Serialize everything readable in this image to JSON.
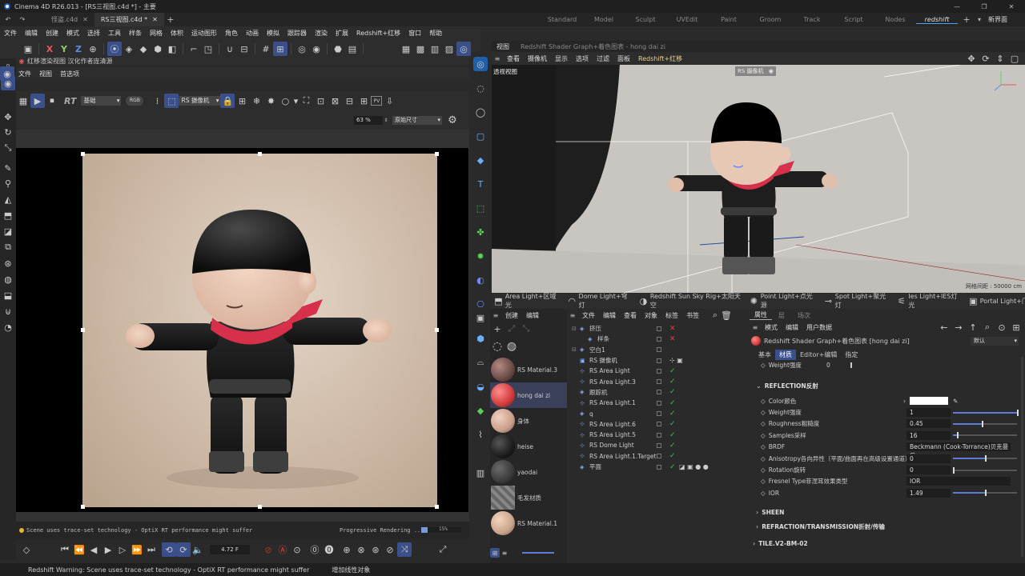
{
  "app": {
    "title": "Cinema 4D R26.013 - [RS三视图.c4d *] - 主要"
  },
  "doc_tabs": [
    {
      "label": "怪盗.c4d",
      "active": false
    },
    {
      "label": "RS三视图.c4d *",
      "active": true
    }
  ],
  "layout_tabs": [
    "Standard",
    "Model",
    "Sculpt",
    "UVEdit",
    "Paint",
    "Groom",
    "Track",
    "Script",
    "Nodes",
    "redshift"
  ],
  "layout_active": "redshift",
  "layout_new": "新界面",
  "menu": [
    "文件",
    "编辑",
    "创建",
    "模式",
    "选择",
    "工具",
    "样条",
    "网格",
    "体积",
    "运动图形",
    "角色",
    "动画",
    "模拟",
    "跟踪器",
    "渲染",
    "扩展",
    "Redshift+红移",
    "窗口",
    "帮助"
  ],
  "axis_labels": [
    "X",
    "Y",
    "Z"
  ],
  "render_view": {
    "title": "红移渲染视图 汉化作者庞清源",
    "menu": [
      "文件",
      "视图",
      "首选项"
    ],
    "rt_label": "RT",
    "mode_select": "基础",
    "color_select": "RGB",
    "camera_select": "RS 摄像机",
    "zoom": "63 %",
    "size_select": "原始尺寸",
    "status_msg": "Scene uses trace-set technology - OptiX RT performance might suffer",
    "progress_label": "Progressive Rendering ..",
    "progress_pct": "15%",
    "frame": "4.72 F"
  },
  "status_bar": {
    "warning": "Redshift Warning: Scene uses trace-set technology - OptiX RT performance might suffer",
    "hint": "增加线性对象"
  },
  "viewport": {
    "tabs": [
      "视图",
      "Redshift Shader Graph+着色图表 - hong dai zi"
    ],
    "menu": [
      "查看",
      "摄像机",
      "显示",
      "选项",
      "过滤",
      "面板",
      "Redshift+红移"
    ],
    "label": "透视视图",
    "camera_label": "RS 摄像机",
    "grid_info": "网格间距 : 50000 cm"
  },
  "light_bar": [
    "Area Light+区域光",
    "Dome Light+穹灯",
    "Redshift Sun Sky Rig+太阳天空",
    "Point Light+点光源",
    "Spot Light+聚光灯",
    "Ies Light+IES灯光",
    "Portal Light+门"
  ],
  "materials": {
    "menu": [
      "创建",
      "编辑"
    ],
    "items": [
      {
        "name": "RS Material.3",
        "color": "#6b4a46"
      },
      {
        "name": "hong dai zi",
        "color": "#d23b3b",
        "selected": true
      },
      {
        "name": "身体",
        "color": "#c9a08c"
      },
      {
        "name": "heise",
        "color": "#1e1e1e"
      },
      {
        "name": "yaodai",
        "color": "#3a3a3a"
      },
      {
        "name": "毛发材质",
        "color": "#777777"
      },
      {
        "name": "RS Material.1",
        "color": "#c9a48c"
      }
    ]
  },
  "objects": {
    "menu": [
      "文件",
      "编辑",
      "查看",
      "对象",
      "标签",
      "书签"
    ],
    "items": [
      {
        "name": "挤压",
        "indent": 0,
        "x": true
      },
      {
        "name": "样条",
        "indent": 1,
        "x": true
      },
      {
        "name": "空白1",
        "indent": 0,
        "x": false
      },
      {
        "name": "RS 摄像机",
        "indent": 0,
        "x": false
      },
      {
        "name": "RS Area Light",
        "indent": 0,
        "x": false
      },
      {
        "name": "RS Area Light.3",
        "indent": 0,
        "x": false
      },
      {
        "name": "跟踪机",
        "indent": 0,
        "x": false
      },
      {
        "name": "RS Area Light.1",
        "indent": 0,
        "x": false
      },
      {
        "name": "q",
        "indent": 0,
        "x": false
      },
      {
        "name": "RS Area Light.6",
        "indent": 0,
        "x": false
      },
      {
        "name": "RS Area Light.5",
        "indent": 0,
        "x": false
      },
      {
        "name": "RS Dome Light",
        "indent": 0,
        "x": false
      },
      {
        "name": "RS Area Light.1.Target",
        "indent": 0,
        "x": false
      },
      {
        "name": "平面",
        "indent": 0,
        "x": false
      }
    ]
  },
  "attributes": {
    "tabs": [
      "属性",
      "层",
      "场次"
    ],
    "menu": [
      "模式",
      "编辑",
      "用户数据"
    ],
    "title": "Redshift Shader Graph+着色图表 [hong dai zi]",
    "preset": "默认",
    "sub_tabs": [
      "基本",
      "材质",
      "Editor+编辑",
      "指定"
    ],
    "weight_top": {
      "label": "Weight强度",
      "value": "0"
    },
    "section_reflection": "REFLECTION反射",
    "rows": [
      {
        "label": "Color颜色",
        "value": "",
        "slider": -1
      },
      {
        "label": "Weight强度",
        "value": "1",
        "slider": 1.0
      },
      {
        "label": "Roughness粗糙度",
        "value": "0.45",
        "slider": 0.45
      },
      {
        "label": "Samples采样",
        "value": "16",
        "slider": 0.06
      },
      {
        "label": "BRDF",
        "value": "Beckmann (Cook-Torrance)贝克曼反",
        "slider": -1
      },
      {
        "label": "Anisotropy各向异性（平面/曲面再在高级设置通道）",
        "value": "0",
        "slider": 0.5
      },
      {
        "label": "Rotation旋转",
        "value": "0",
        "slider": 0.0
      },
      {
        "label": "Fresnel Type菲涅耳效果类型",
        "value": "IOR",
        "slider": -1
      },
      {
        "label": "IOR",
        "value": "1.49",
        "slider": 0.5
      }
    ],
    "sections": [
      "SHEEN",
      "REFRACTION/TRANSMISSION折射/传输",
      "TILE.V2-BM-02"
    ]
  }
}
